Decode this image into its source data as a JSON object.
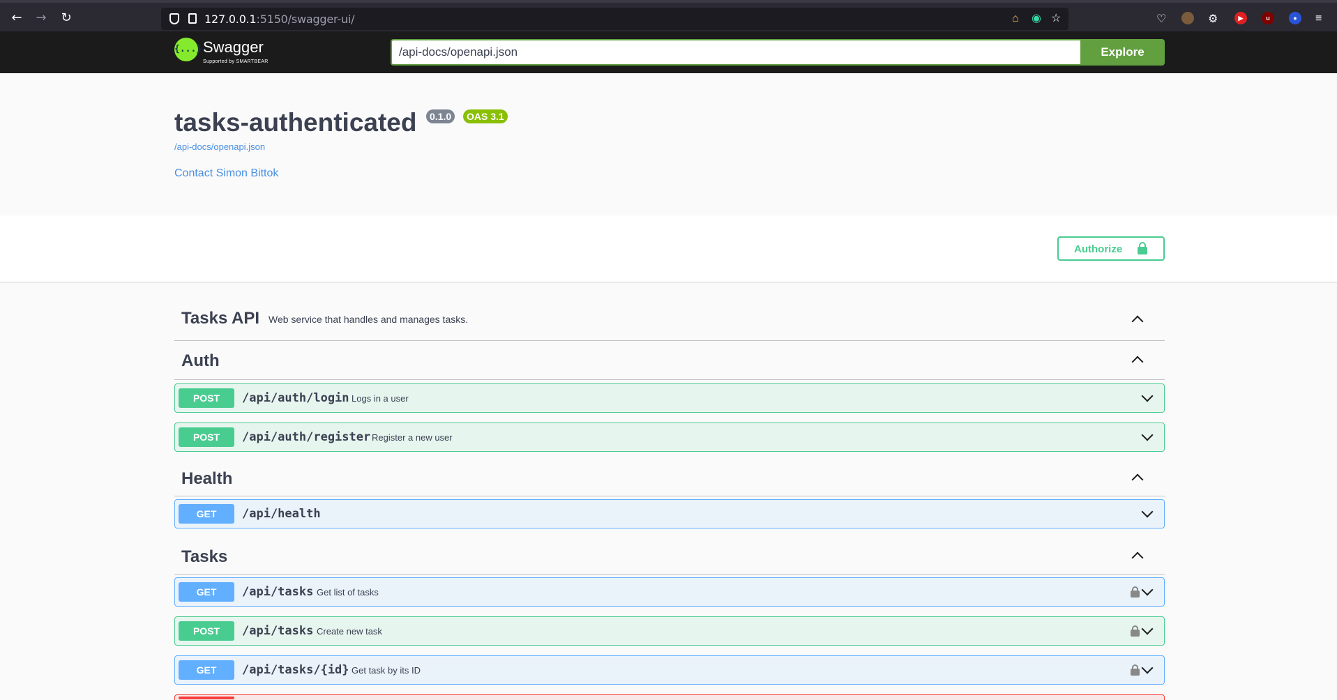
{
  "browser": {
    "url_host": "127.0.0.1",
    "url_path": ":5150/swagger-ui/",
    "icons": [
      "back-icon",
      "forward-icon",
      "reload-icon",
      "shield-icon",
      "page-icon",
      "home-icon",
      "bookmark-star-icon",
      "pocket-icon",
      "extensions-icon",
      "menu-icon"
    ]
  },
  "topbar": {
    "logo_text": "Swagger",
    "logo_sub": "Supported by SMARTBEAR",
    "logo_glyph": "{...}",
    "spec_url": "/api-docs/openapi.json",
    "explore_label": "Explore"
  },
  "info": {
    "title": "tasks-authenticated",
    "version": "0.1.0",
    "oas": "OAS 3.1",
    "spec_link": "/api-docs/openapi.json",
    "contact": "Contact Simon Bittok"
  },
  "scheme": {
    "authorize_label": "Authorize"
  },
  "sections": [
    {
      "title": "Tasks API",
      "description": "Web service that handles and manages tasks."
    },
    {
      "title": "Auth"
    },
    {
      "title": "Health"
    },
    {
      "title": "Tasks"
    }
  ],
  "operations": {
    "auth": [
      {
        "method": "POST",
        "path": "/api/auth/login",
        "summary": "Logs in a user"
      },
      {
        "method": "POST",
        "path": "/api/auth/register",
        "summary": "Register a new user"
      }
    ],
    "health": [
      {
        "method": "GET",
        "path": "/api/health",
        "summary": ""
      }
    ],
    "tasks": [
      {
        "method": "GET",
        "path": "/api/tasks",
        "summary": "Get list of tasks"
      },
      {
        "method": "POST",
        "path": "/api/tasks",
        "summary": "Create new task"
      },
      {
        "method": "GET",
        "path": "/api/tasks/{id}",
        "summary": "Get task by its ID"
      }
    ]
  },
  "colors": {
    "post": "#49cc90",
    "get": "#61affe",
    "delete": "#f93e3e",
    "explore": "#62a03f"
  }
}
